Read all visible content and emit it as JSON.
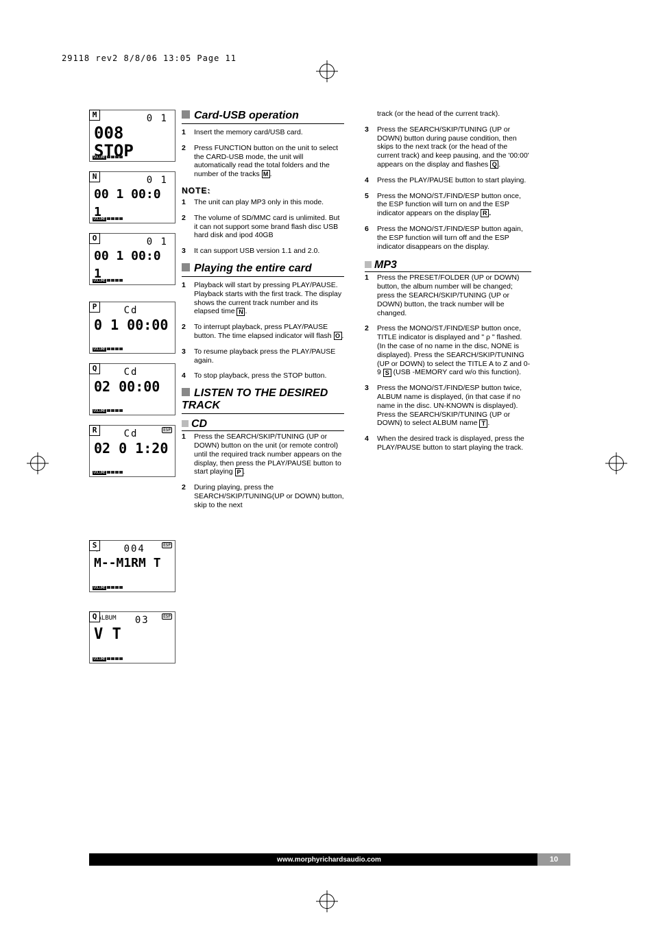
{
  "header": {
    "runline": "29118 rev2  8/8/06  13:05  Page 11"
  },
  "displays": {
    "M": {
      "top": "0 1",
      "big": "008 STOP"
    },
    "N": {
      "top": "0 1",
      "big": "00 1 00:0 1"
    },
    "O": {
      "top": "0 1",
      "big": "00 1 00:0 1"
    },
    "P": {
      "top": "Cd",
      "big": "0 1 00:00"
    },
    "Q": {
      "top": "Cd",
      "big": "02 00:00"
    },
    "R": {
      "top": "Cd",
      "big": "02 0 1:20",
      "esp": "ESP"
    },
    "S": {
      "top": "004",
      "big": "M--M1RM T",
      "esp": "ESP",
      "snow": "❄"
    },
    "Q2": {
      "top": "03",
      "big": "V T",
      "album": "ρALBUM",
      "esp": "ESP"
    },
    "volume": "VOLUME"
  },
  "sections": {
    "cardusb": {
      "title": "Card-USB operation",
      "steps": [
        "Insert the memory card/USB card.",
        "Press FUNCTION button on the unit to select the CARD-USB mode, the unit will automatically read the total folders and the number of the tracks "
      ],
      "stepsRef": "M",
      "note_hdr": "NOTE:",
      "notes": [
        "The unit can play MP3 only in this mode.",
        "The volume of SD/MMC card is unlimited. But it can not support some brand flash disc USB hard disk and ipod 40GB",
        "It can support USB version 1.1 and 2.0."
      ]
    },
    "playcard": {
      "title": "Playing the entire card",
      "steps": [
        {
          "t": "Playback will start by pressing PLAY/PAUSE. Playback starts with the first track. The display shows the current track number and its elapsed time ",
          "ref": "N"
        },
        {
          "t": "To interrupt playback, press PLAY/PAUSE button. The time elapsed indicator will flash ",
          "ref": "O"
        },
        {
          "t": "To resume playback press the PLAY/PAUSE again."
        },
        {
          "t": "To stop playback, press the STOP button."
        }
      ]
    },
    "listen": {
      "title": "LISTEN TO THE DESIRED TRACK",
      "cd": "CD",
      "cd_steps": [
        {
          "t": "Press the SEARCH/SKIP/TUNING (UP or DOWN) button on the unit  (or remote control) until the required track number appears on the display, then press the PLAY/PAUSE button to start playing ",
          "ref": "P"
        },
        {
          "t": "During playing, press the SEARCH/SKIP/TUNING(UP or DOWN) button, skip to the next"
        }
      ],
      "cd_cont": "track (or the head of the current track).",
      "cd_more": [
        {
          "n": "3",
          "t": "Press the SEARCH/SKIP/TUNING (UP or DOWN) button during pause condition, then skips to the next track (or the head of the current track) and keep pausing, and the '00:00' appears on the display and flashes ",
          "ref": "Q"
        },
        {
          "n": "4",
          "t": "Press the PLAY/PAUSE button to start playing."
        },
        {
          "n": "5",
          "t": "Press the MONO/ST./FIND/ESP button once, the ESP function will turn on and the ESP indicator appears on the display ",
          "ref": "R",
          "suffix": "."
        },
        {
          "n": "6",
          "t": "Press the MONO/ST./FIND/ESP button again, the ESP function will turn off and the ESP indicator disappears on the display."
        }
      ]
    },
    "mp3": {
      "title": "MP3",
      "steps": [
        {
          "n": "1",
          "t": "Press the PRESET/FOLDER (UP or DOWN) button, the album number will be changed; press the SEARCH/SKIP/TUNING (UP or DOWN) button, the track number will be changed."
        },
        {
          "n": "2",
          "pre": "Press the MONO/ST./FIND/ESP button once, TITLE indicator is displayed and \" ",
          "mid": "ρ",
          "post": " \" flashed. (In the case of no name in the disc, NONE is displayed). Press the SEARCH/SKIP/TUNING (UP or DOWN) to select the TITLE A to Z and 0-9 ",
          "ref": "S",
          "suffix": " (USB -MEMORY card w/o this function)."
        },
        {
          "n": "3",
          "t": "Press the MONO/ST./FIND/ESP button twice, ALBUM name is displayed, (in that case if no name in the disc. UN-KNOWN is displayed). Press the SEARCH/SKIP/TUNING (UP or DOWN) to select ALBUM name ",
          "ref": "T",
          "suffix": "."
        },
        {
          "n": "4",
          "t": "When the desired track is displayed, press the PLAY/PAUSE button to start playing the track."
        }
      ]
    }
  },
  "footer": {
    "url": "www.morphyrichardsaudio.com",
    "page": "10"
  }
}
